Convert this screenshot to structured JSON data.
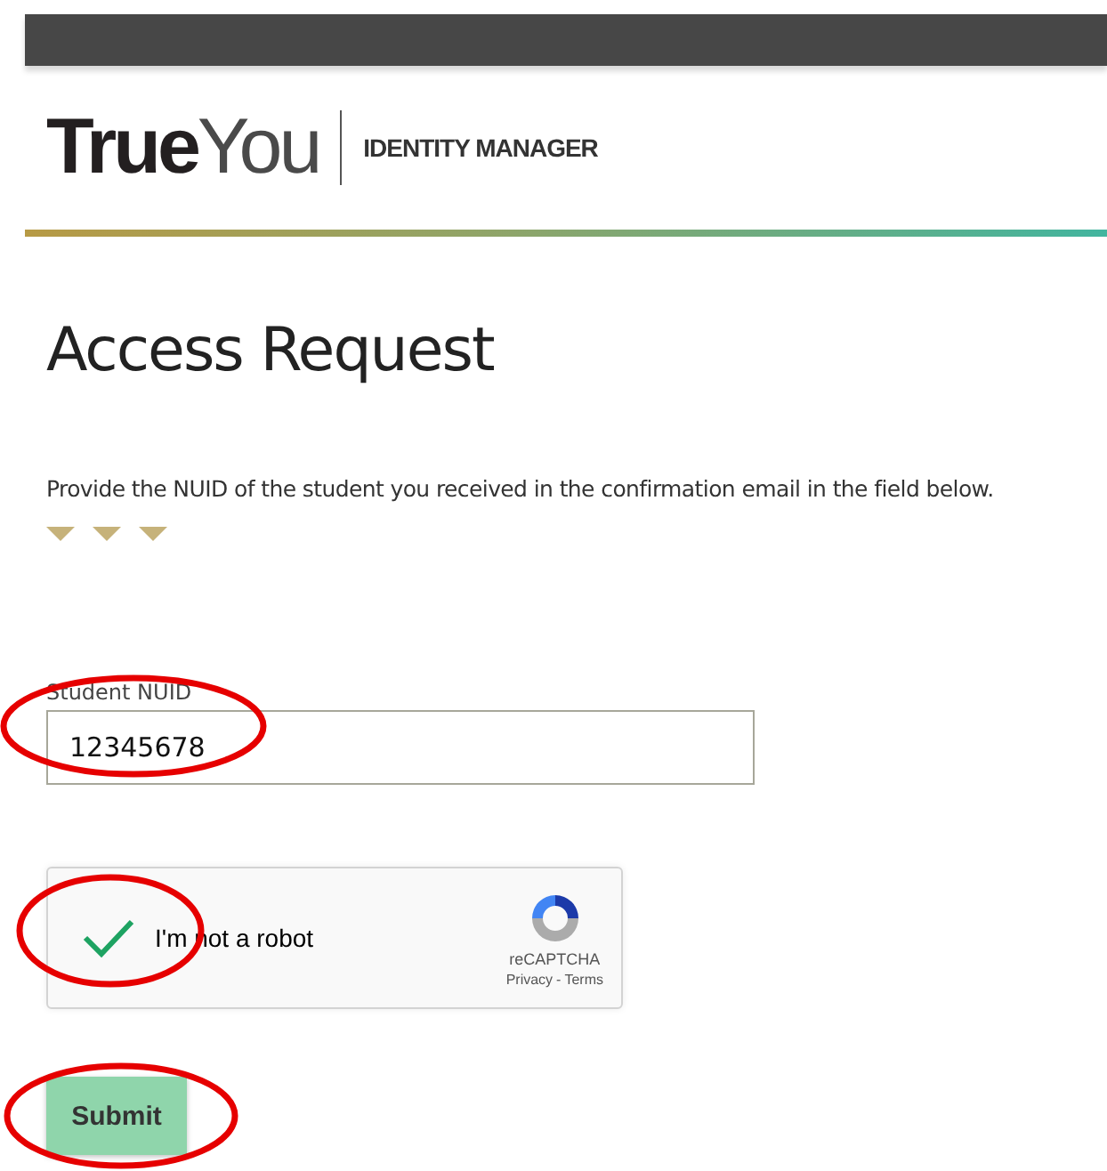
{
  "header": {
    "logo": {
      "strong": "True",
      "light": "You"
    },
    "subtitle": "IDENTITY MANAGER"
  },
  "page": {
    "title": "Access Request",
    "instructions": "Provide the NUID of the student you received in the confirmation email in the field below."
  },
  "form": {
    "field": {
      "label": "Student NUID",
      "value": "12345678",
      "circled": true
    },
    "captcha": {
      "label": "I'm not a robot",
      "checked": true,
      "circled": true,
      "brand": "reCAPTCHA",
      "links": [
        "Privacy",
        "-",
        "Terms"
      ]
    },
    "submit": {
      "label": "Submit",
      "circled": true
    }
  }
}
